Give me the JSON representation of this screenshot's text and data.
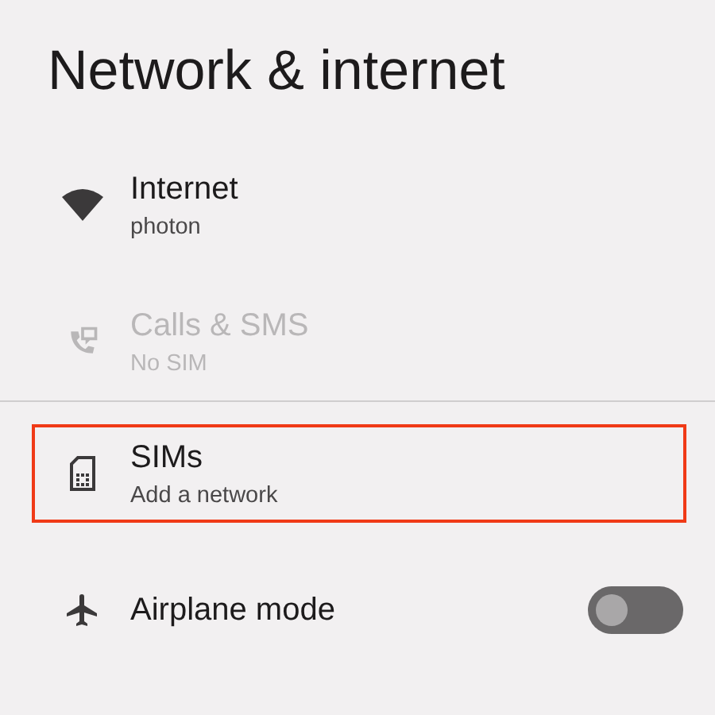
{
  "title": "Network & internet",
  "sections": [
    {
      "items": [
        {
          "kind": "nav",
          "title": "Internet",
          "subtitle": "photon",
          "disabled": false,
          "highlighted": false
        },
        {
          "kind": "nav",
          "title": "Calls & SMS",
          "subtitle": "No SIM",
          "disabled": true,
          "highlighted": false
        }
      ]
    },
    {
      "items": [
        {
          "kind": "nav",
          "title": "SIMs",
          "subtitle": "Add a network",
          "disabled": false,
          "highlighted": true
        },
        {
          "kind": "toggle",
          "title": "Airplane mode",
          "disabled": false,
          "highlighted": false,
          "on": false
        }
      ]
    }
  ]
}
